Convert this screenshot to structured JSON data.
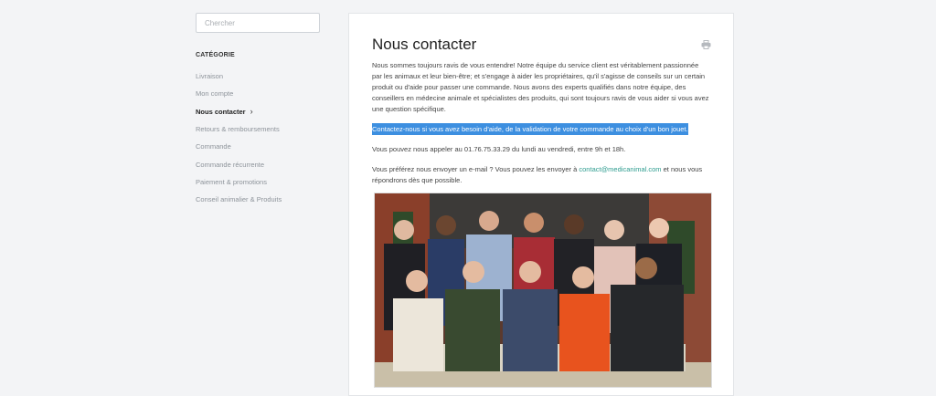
{
  "search": {
    "placeholder": "Chercher"
  },
  "sidebar": {
    "heading": "CATÉGORIE",
    "items": [
      {
        "label": "Livraison"
      },
      {
        "label": "Mon compte"
      },
      {
        "label": "Nous contacter",
        "chevron": "›"
      },
      {
        "label": "Retours & remboursements"
      },
      {
        "label": "Commande"
      },
      {
        "label": "Commande récurrente"
      },
      {
        "label": "Paiement & promotions"
      },
      {
        "label": "Conseil animalier & Produits"
      }
    ]
  },
  "article": {
    "title": "Nous contacter",
    "paragraph1": "Nous sommes toujours ravis de vous entendre! Notre équipe du service client est véritablement passionnée par les animaux et leur bien-être; et s'engage à aider les propriétaires, qu'il s'agisse de conseils sur un certain produit ou d'aide pour passer une commande. Nous avons des experts qualifiés dans notre équipe, des conseillers en médecine animale et spécialistes des produits, qui sont toujours ravis de vous aider si vous avez une question spécifique.",
    "highlight": "Contactez-nous si vous avez besoin d'aide, de la validation de votre commande au choix d'un bon jouet.",
    "phone": "Vous pouvez nous appeler au 01.76.75.33.29 du lundi au vendredi, entre 9h et 18h.",
    "email_before": "Vous préférez nous envoyer un e-mail ? Vous pouvez les envoyer à ",
    "email_link": "contact@medicanimal.com",
    "email_after": " et nous vous répondrons dès que possible."
  },
  "icons": {
    "print": "printer-icon"
  },
  "colors": {
    "highlight": "#3d8fe0",
    "link": "#2d9c8f",
    "background": "#f3f4f6"
  }
}
